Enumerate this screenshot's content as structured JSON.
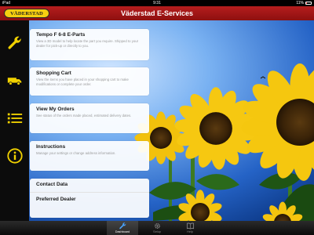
{
  "status_bar": {
    "carrier": "iPad",
    "time": "9:31",
    "battery": "11%"
  },
  "header": {
    "logo_text": "VÄDERSTAD",
    "title": "Väderstad E-Services"
  },
  "menu": {
    "items": [
      {
        "title": "Tempo F 6-8 E-Parts",
        "description": "View a 3D model to help locate the part you require. Shipped to your dealer for pick-up or directly to you.",
        "icon": "wrench-icon"
      },
      {
        "title": "Shopping Cart",
        "description": "View the items you have placed in your shopping cart to make modifications or complete your order.",
        "icon": "truck-icon"
      },
      {
        "title": "View My Orders",
        "description": "See status of the orders made placed, estimated delivery dates.",
        "icon": "list-icon"
      },
      {
        "title": "Instructions",
        "description": "Manage your settings or change address information.",
        "icon": "info-icon"
      }
    ],
    "links": [
      "Contact Data",
      "Preferred Dealer"
    ]
  },
  "tab_bar": {
    "tabs": [
      {
        "label": "Dashboard",
        "icon": "wrench-icon",
        "active": true
      },
      {
        "label": "Setup",
        "icon": "gear-icon",
        "active": false
      },
      {
        "label": "Help",
        "icon": "book-icon",
        "active": false
      }
    ]
  },
  "colors": {
    "header_red": "#9a1515",
    "logo_yellow": "#f6cf10",
    "icon_yellow": "#f2d200",
    "sky_blue": "#3f86df"
  }
}
